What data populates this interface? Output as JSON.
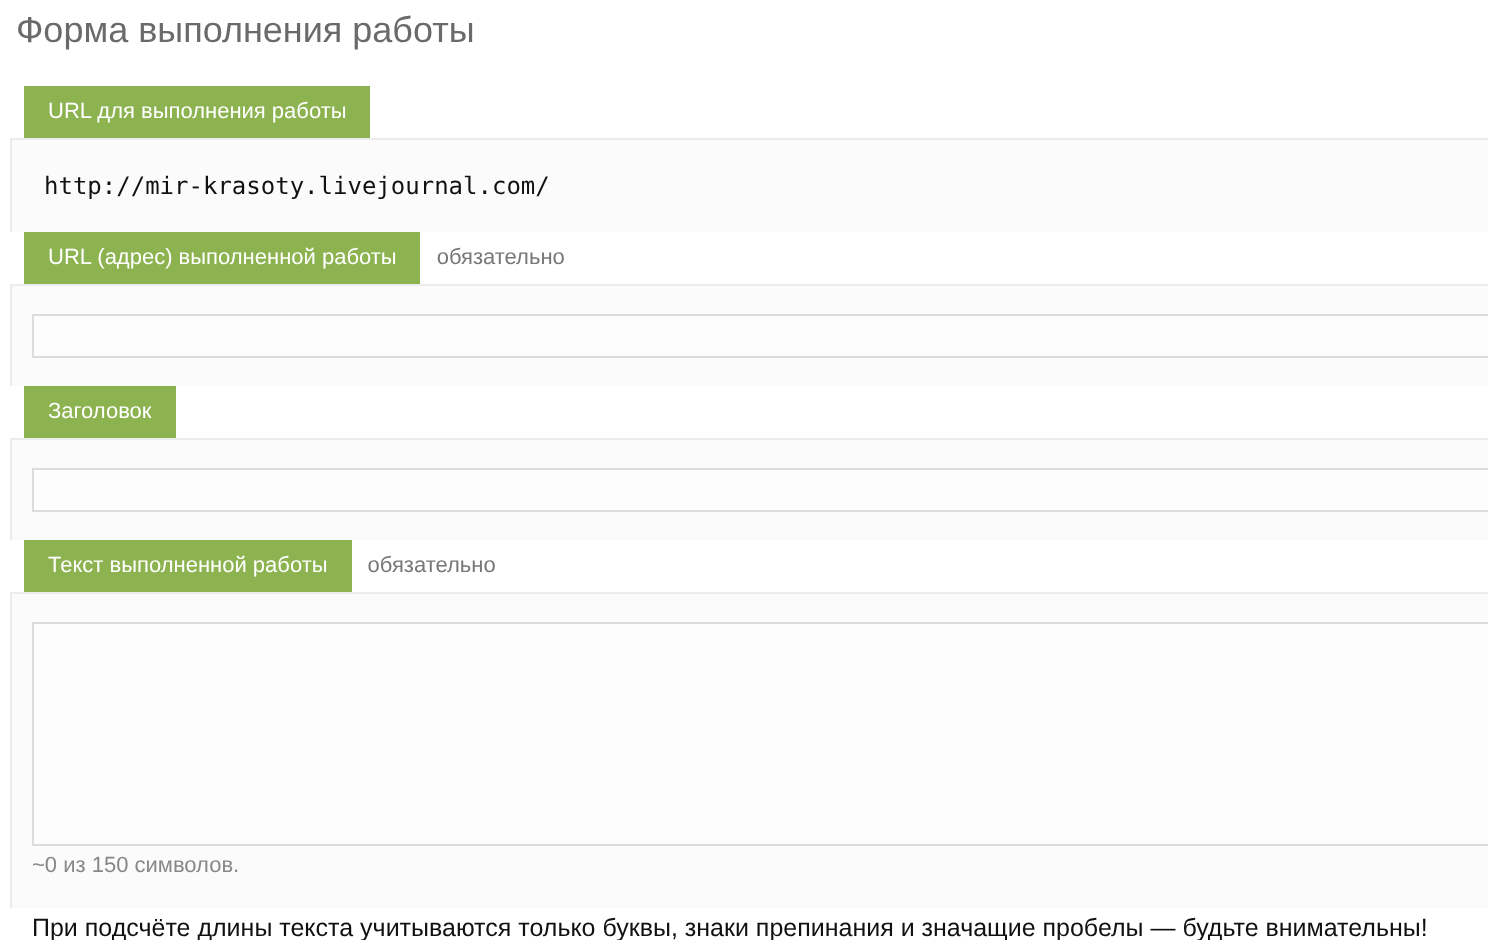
{
  "title": "Форма выполнения работы",
  "fields": [
    {
      "label": "URL для выполнения работы",
      "kind": "text",
      "value": "http://mir-krasoty.livejournal.com/"
    },
    {
      "label": "URL (адрес) выполненной работы",
      "required": "обязательно",
      "kind": "input"
    },
    {
      "label": "Заголовок",
      "kind": "input"
    },
    {
      "label": "Текст выполненной работы",
      "required": "обязательно",
      "kind": "textarea",
      "counter": "~0 из 150 символов."
    }
  ],
  "notice": "При подсчёте длины текста учитываются только буквы, знаки препинания и значащие пробелы — будьте внимательны!"
}
